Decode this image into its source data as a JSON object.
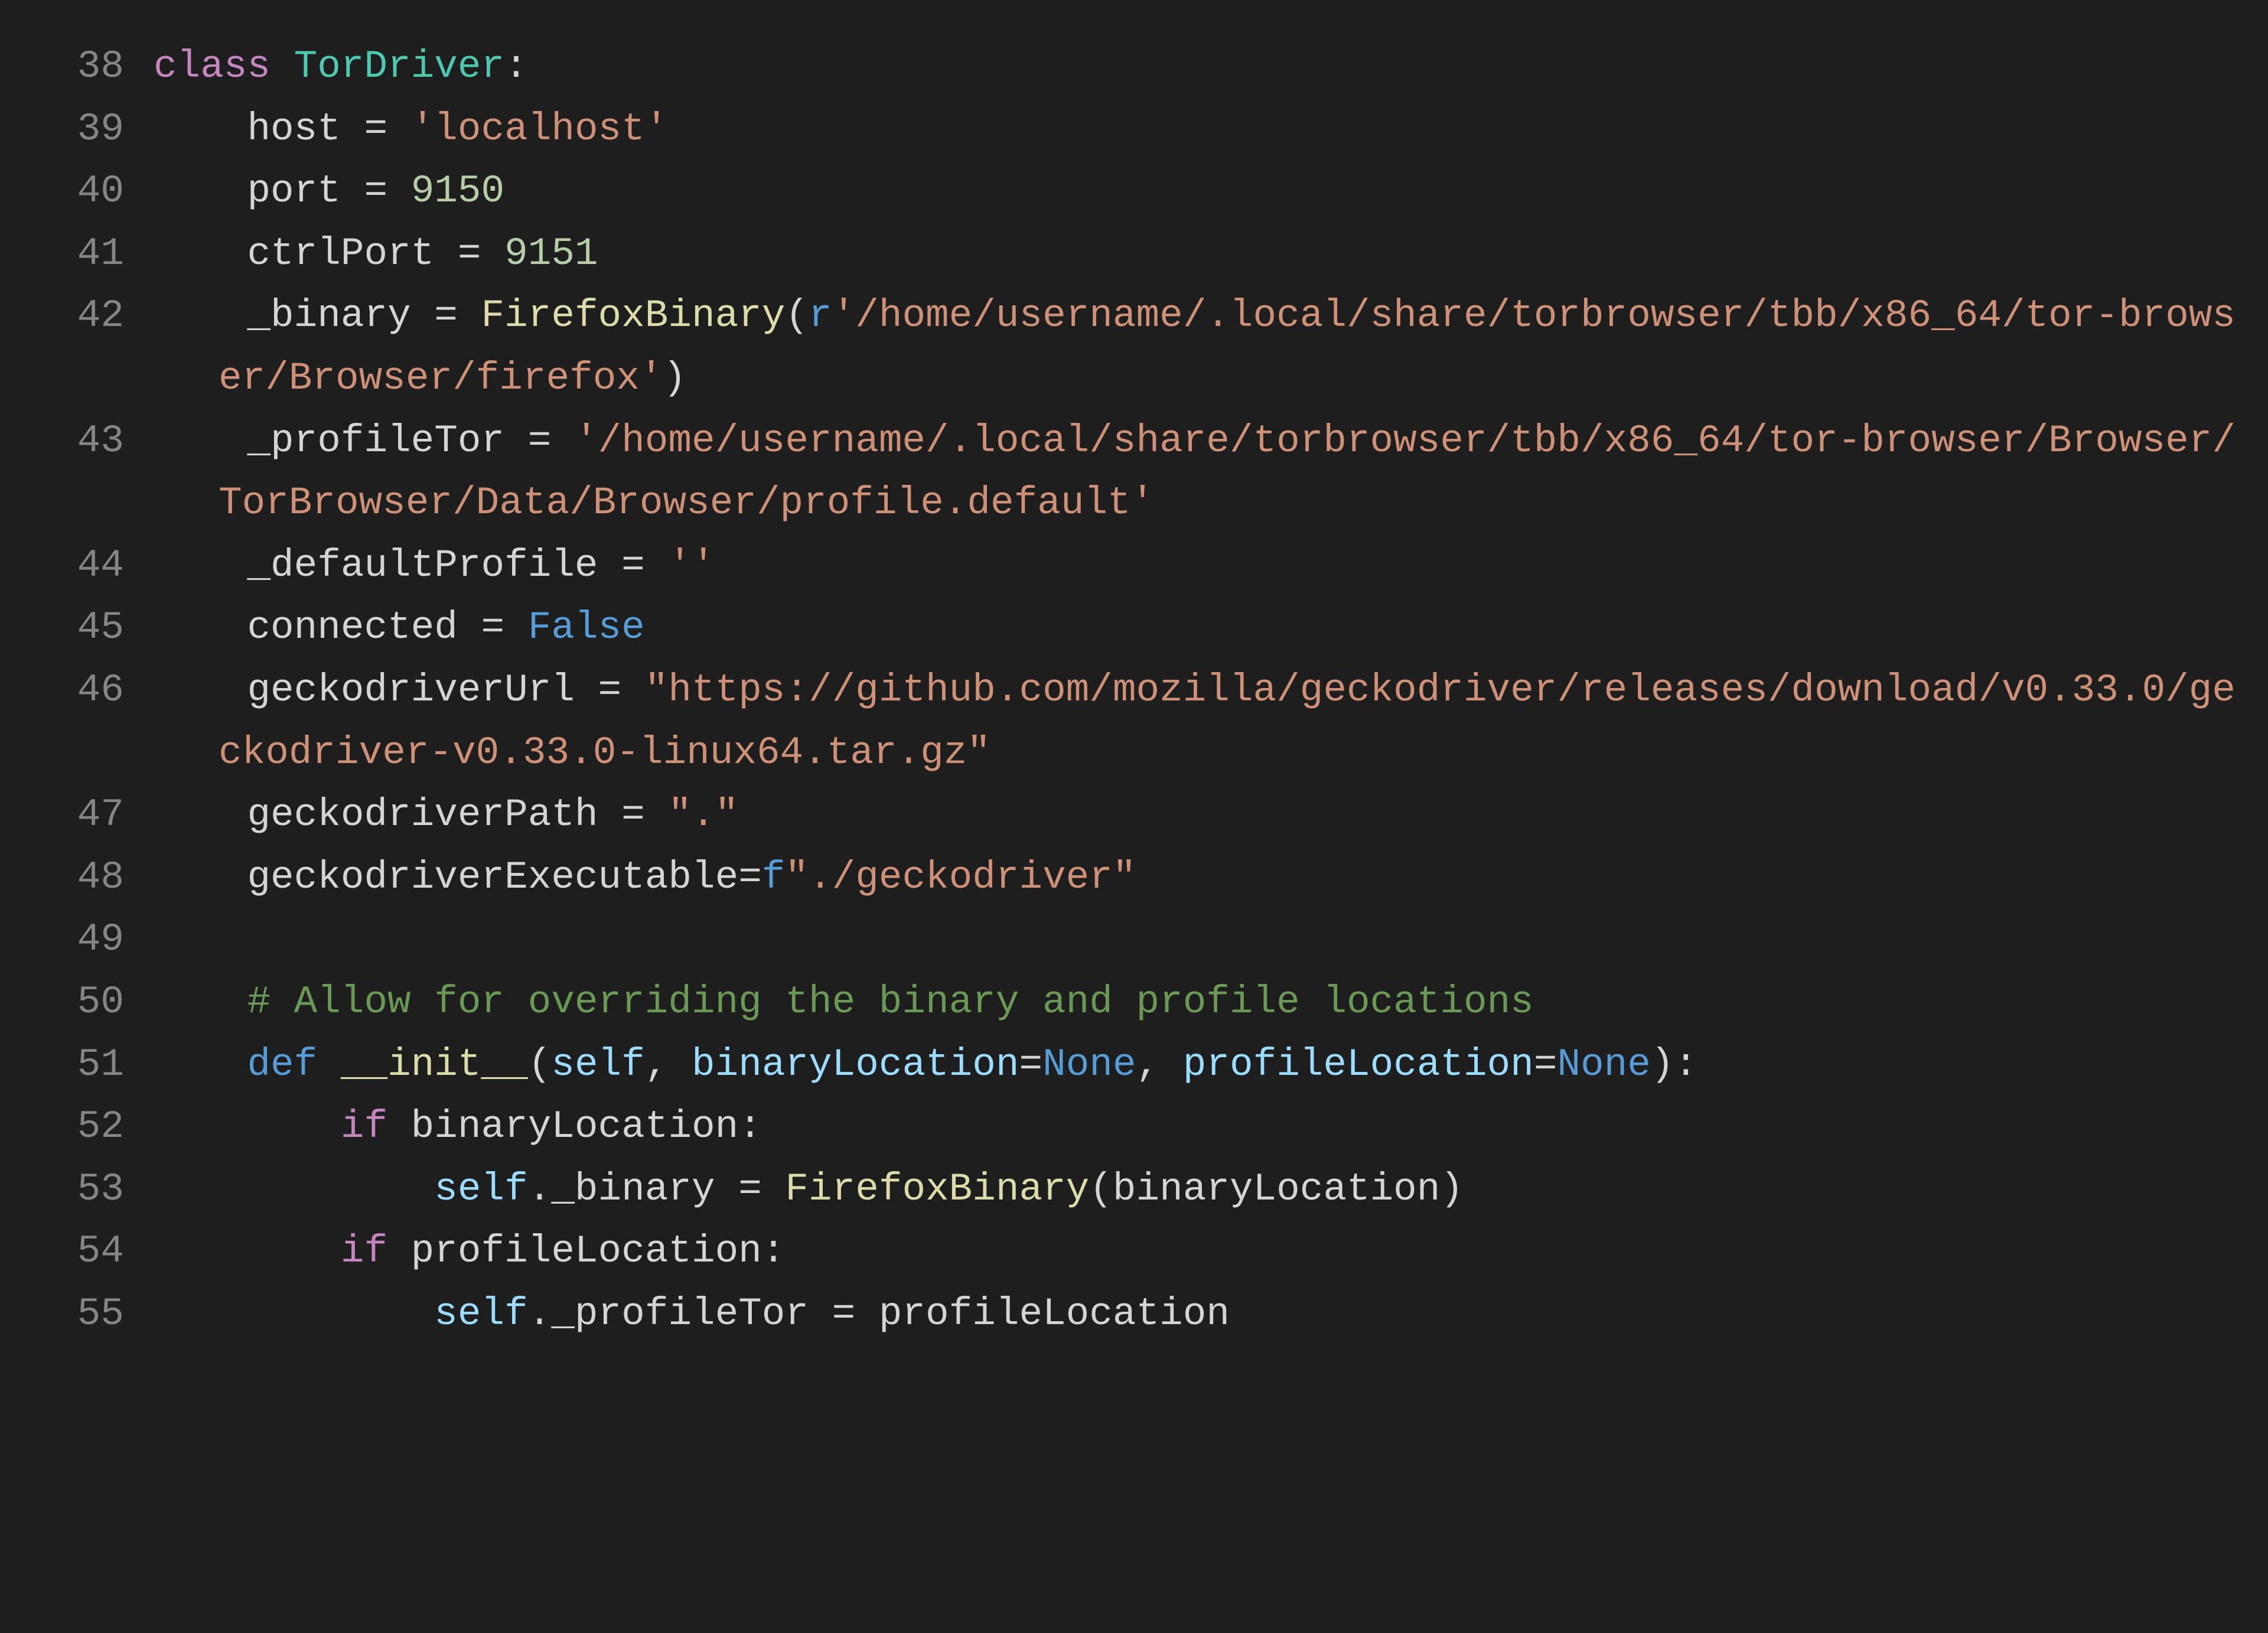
{
  "lines": [
    {
      "num": "38",
      "segments": [
        {
          "cls": "tok-kw",
          "t": "class "
        },
        {
          "cls": "tok-class",
          "t": "TorDriver"
        },
        {
          "cls": "tok-punc",
          "t": ":"
        }
      ]
    },
    {
      "num": "39",
      "segments": [
        {
          "cls": "tok-ident",
          "t": "    host "
        },
        {
          "cls": "tok-op",
          "t": "="
        },
        {
          "cls": "tok-ident",
          "t": " "
        },
        {
          "cls": "tok-str",
          "t": "'localhost'"
        }
      ]
    },
    {
      "num": "40",
      "segments": [
        {
          "cls": "tok-ident",
          "t": "    port "
        },
        {
          "cls": "tok-op",
          "t": "="
        },
        {
          "cls": "tok-ident",
          "t": " "
        },
        {
          "cls": "tok-num",
          "t": "9150"
        }
      ]
    },
    {
      "num": "41",
      "segments": [
        {
          "cls": "tok-ident",
          "t": "    ctrlPort "
        },
        {
          "cls": "tok-op",
          "t": "="
        },
        {
          "cls": "tok-ident",
          "t": " "
        },
        {
          "cls": "tok-num",
          "t": "9151"
        }
      ]
    },
    {
      "num": "42",
      "segments": [
        {
          "cls": "tok-ident",
          "t": "    _binary "
        },
        {
          "cls": "tok-op",
          "t": "="
        },
        {
          "cls": "tok-ident",
          "t": " "
        },
        {
          "cls": "tok-func",
          "t": "FirefoxBinary"
        },
        {
          "cls": "tok-punc",
          "t": "("
        },
        {
          "cls": "tok-def",
          "t": "r"
        },
        {
          "cls": "tok-str",
          "t": "'/home/username/.local/share/torbrowser/tbb/x86_64/tor-browser/Browser/firefox'"
        },
        {
          "cls": "tok-punc",
          "t": ")"
        }
      ]
    },
    {
      "num": "43",
      "segments": [
        {
          "cls": "tok-ident",
          "t": "    _profileTor "
        },
        {
          "cls": "tok-op",
          "t": "="
        },
        {
          "cls": "tok-ident",
          "t": " "
        },
        {
          "cls": "tok-str",
          "t": "'/home/username/.local/share/torbrowser/tbb/x86_64/tor-browser/Browser/TorBrowser/Data/Browser/profile.default'"
        }
      ]
    },
    {
      "num": "44",
      "segments": [
        {
          "cls": "tok-ident",
          "t": "    _defaultProfile "
        },
        {
          "cls": "tok-op",
          "t": "="
        },
        {
          "cls": "tok-ident",
          "t": " "
        },
        {
          "cls": "tok-str",
          "t": "''"
        }
      ]
    },
    {
      "num": "45",
      "segments": [
        {
          "cls": "tok-ident",
          "t": "    connected "
        },
        {
          "cls": "tok-op",
          "t": "="
        },
        {
          "cls": "tok-ident",
          "t": " "
        },
        {
          "cls": "tok-bool",
          "t": "False"
        }
      ]
    },
    {
      "num": "46",
      "segments": [
        {
          "cls": "tok-ident",
          "t": "    geckodriverUrl "
        },
        {
          "cls": "tok-op",
          "t": "="
        },
        {
          "cls": "tok-ident",
          "t": " "
        },
        {
          "cls": "tok-str",
          "t": "\"https://github.com/mozilla/geckodriver/releases/download/v0.33.0/geckodriver-v0.33.0-linux64.tar.gz\""
        }
      ]
    },
    {
      "num": "47",
      "segments": [
        {
          "cls": "tok-ident",
          "t": "    geckodriverPath "
        },
        {
          "cls": "tok-op",
          "t": "="
        },
        {
          "cls": "tok-ident",
          "t": " "
        },
        {
          "cls": "tok-str",
          "t": "\".\""
        }
      ]
    },
    {
      "num": "48",
      "segments": [
        {
          "cls": "tok-ident",
          "t": "    geckodriverExecutable"
        },
        {
          "cls": "tok-op",
          "t": "="
        },
        {
          "cls": "tok-def",
          "t": "f"
        },
        {
          "cls": "tok-str",
          "t": "\"./geckodriver\""
        }
      ]
    },
    {
      "num": "49",
      "segments": [
        {
          "cls": "tok-ident",
          "t": ""
        }
      ]
    },
    {
      "num": "50",
      "segments": [
        {
          "cls": "tok-ident",
          "t": "    "
        },
        {
          "cls": "tok-comment",
          "t": "# Allow for overriding the binary and profile locations"
        }
      ]
    },
    {
      "num": "51",
      "segments": [
        {
          "cls": "tok-ident",
          "t": "    "
        },
        {
          "cls": "tok-def",
          "t": "def "
        },
        {
          "cls": "tok-method",
          "t": "__init__"
        },
        {
          "cls": "tok-punc",
          "t": "("
        },
        {
          "cls": "tok-self",
          "t": "self"
        },
        {
          "cls": "tok-punc",
          "t": ", "
        },
        {
          "cls": "tok-prop",
          "t": "binaryLocation"
        },
        {
          "cls": "tok-op",
          "t": "="
        },
        {
          "cls": "tok-bool",
          "t": "None"
        },
        {
          "cls": "tok-punc",
          "t": ", "
        },
        {
          "cls": "tok-prop",
          "t": "profileLocation"
        },
        {
          "cls": "tok-op",
          "t": "="
        },
        {
          "cls": "tok-bool",
          "t": "None"
        },
        {
          "cls": "tok-punc",
          "t": "):"
        }
      ]
    },
    {
      "num": "52",
      "segments": [
        {
          "cls": "tok-ident",
          "t": "        "
        },
        {
          "cls": "tok-kw",
          "t": "if"
        },
        {
          "cls": "tok-ident",
          "t": " binaryLocation"
        },
        {
          "cls": "tok-punc",
          "t": ":"
        }
      ]
    },
    {
      "num": "53",
      "segments": [
        {
          "cls": "tok-ident",
          "t": "            "
        },
        {
          "cls": "tok-self",
          "t": "self"
        },
        {
          "cls": "tok-punc",
          "t": "."
        },
        {
          "cls": "tok-ident",
          "t": "_binary "
        },
        {
          "cls": "tok-op",
          "t": "="
        },
        {
          "cls": "tok-ident",
          "t": " "
        },
        {
          "cls": "tok-func",
          "t": "FirefoxBinary"
        },
        {
          "cls": "tok-punc",
          "t": "("
        },
        {
          "cls": "tok-ident",
          "t": "binaryLocation"
        },
        {
          "cls": "tok-punc",
          "t": ")"
        }
      ]
    },
    {
      "num": "54",
      "segments": [
        {
          "cls": "tok-ident",
          "t": "        "
        },
        {
          "cls": "tok-kw",
          "t": "if"
        },
        {
          "cls": "tok-ident",
          "t": " profileLocation"
        },
        {
          "cls": "tok-punc",
          "t": ":"
        }
      ]
    },
    {
      "num": "55",
      "segments": [
        {
          "cls": "tok-ident",
          "t": "            "
        },
        {
          "cls": "tok-self",
          "t": "self"
        },
        {
          "cls": "tok-punc",
          "t": "."
        },
        {
          "cls": "tok-ident",
          "t": "_profileTor "
        },
        {
          "cls": "tok-op",
          "t": "="
        },
        {
          "cls": "tok-ident",
          "t": " profileLocation"
        }
      ]
    }
  ]
}
